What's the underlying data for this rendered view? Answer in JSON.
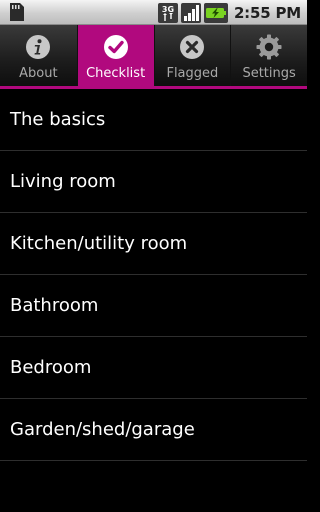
{
  "status_bar": {
    "time": "2:55 PM",
    "network_type": "3G",
    "icons": [
      "sd-card-icon",
      "network-3g-icon",
      "signal-icon",
      "battery-icon"
    ]
  },
  "tabs": [
    {
      "label": "About",
      "icon": "info-icon",
      "active": false
    },
    {
      "label": "Checklist",
      "icon": "check-icon",
      "active": true
    },
    {
      "label": "Flagged",
      "icon": "cross-icon",
      "active": false
    },
    {
      "label": "Settings",
      "icon": "gear-icon",
      "active": false
    }
  ],
  "list": {
    "items": [
      "The basics",
      "Living room",
      "Kitchen/utility room",
      "Bathroom",
      "Bedroom",
      "Garden/shed/garage"
    ]
  },
  "colors": {
    "accent": "#b1097e",
    "background": "#000000",
    "divider": "#2e2e2e"
  }
}
